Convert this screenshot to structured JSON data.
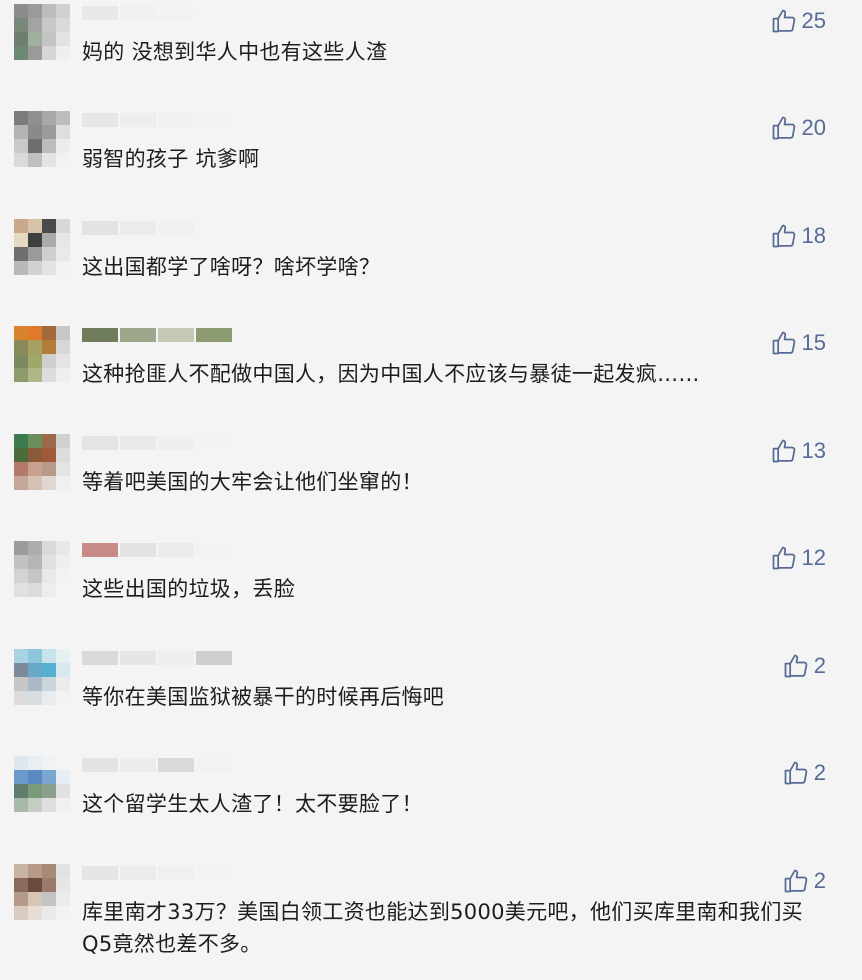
{
  "colors": {
    "like": "#576b95",
    "text": "#1d1d1d",
    "background": "#f4f4f4"
  },
  "comments": [
    {
      "text": "妈的  没想到华人中也有这些人渣",
      "likes": "25",
      "avatar": [
        "#8c8c8c",
        "#9a9a9a",
        "#bdbdbd",
        "#d0d0d0",
        "#7a8a7a",
        "#a3a3a3",
        "#c7c7c7",
        "#dadada",
        "#6f7f6f",
        "#9fb09f",
        "#c4c4c4",
        "#e2e2e2",
        "#6a8a74",
        "#9a9a9a",
        "#d6d6d6",
        "#efefef"
      ],
      "name": [
        "#e8e8e8",
        "#f0f0f0",
        "#f2f2f2",
        "#f4f4f4"
      ]
    },
    {
      "text": "弱智的孩子  坑爹啊",
      "likes": "20",
      "avatar": [
        "#7b7b7b",
        "#909090",
        "#a8a8a8",
        "#bdbdbd",
        "#b3b3b3",
        "#8a8a8a",
        "#9b9b9b",
        "#dedede",
        "#c9c9c9",
        "#6e6e6e",
        "#bcbcbc",
        "#ececec",
        "#dadada",
        "#bfbfbf",
        "#e4e4e4",
        "#f2f2f2"
      ],
      "name": [
        "#e6e6e6",
        "#eeeeee",
        "#f1f1f1",
        "#f3f3f3"
      ]
    },
    {
      "text": "这出国都学了啥呀？啥坏学啥？",
      "likes": "18",
      "avatar": [
        "#c9a98a",
        "#d8c3a8",
        "#4a4a4a",
        "#d7d7d7",
        "#e8d9c4",
        "#3f3f3f",
        "#aaaaaa",
        "#e6e6e6",
        "#6e6e6e",
        "#9a9a9a",
        "#cfcfcf",
        "#e9e9e9",
        "#b9b9b9",
        "#d1d1d1",
        "#e3e3e3",
        "#f2f2f2"
      ],
      "name": [
        "#e2e2e2",
        "#ebebeb",
        "#f0f0f0",
        "#f4f4f4"
      ]
    },
    {
      "text": "这种抢匪人不配做中国人，因为中国人不应该与暴徒一起发疯……",
      "likes": "15",
      "avatar": [
        "#d9832f",
        "#e07a2a",
        "#a06a3a",
        "#c7c7c7",
        "#8a8a5a",
        "#a8a060",
        "#b07d3a",
        "#d8d8d8",
        "#7c8a5e",
        "#9fa86a",
        "#cfcfcf",
        "#e4e4e4",
        "#8d9c6a",
        "#b0b58a",
        "#dcdcdc",
        "#efefef"
      ],
      "name": [
        "#6f7c5c",
        "#9ba68a",
        "#c3c9b5",
        "#8c9b70"
      ]
    },
    {
      "text": "等着吧美国的大牢会让他们坐窜的！",
      "likes": "13",
      "avatar": [
        "#3d7a4e",
        "#6a8f5a",
        "#9c6a4a",
        "#d0d0d0",
        "#4d6b3b",
        "#8a5a3a",
        "#a05a3a",
        "#dcdcdc",
        "#b37a6a",
        "#c9a090",
        "#b89a8a",
        "#e4e4e4",
        "#c6a89a",
        "#d6c0b5",
        "#e3d6d0",
        "#f0f0f0"
      ],
      "name": [
        "#e4e4e4",
        "#eaeaea",
        "#efefef",
        "#f3f3f3"
      ]
    },
    {
      "text": "这些出国的垃圾，丢脸",
      "likes": "12",
      "avatar": [
        "#9b9b9b",
        "#adadad",
        "#d9d9d9",
        "#e8e8e8",
        "#c2c2c2",
        "#b5b5b5",
        "#e0e0e0",
        "#efefef",
        "#d3d3d3",
        "#c6c6c6",
        "#e8e8e8",
        "#f2f2f2",
        "#e0e0e0",
        "#dbdbdb",
        "#ededed",
        "#f5f5f5"
      ],
      "name": [
        "#c98a8a",
        "#e2e2e2",
        "#ececec",
        "#f2f2f2"
      ]
    },
    {
      "text": "等你在美国监狱被暴干的时候再后悔吧",
      "likes": "2",
      "avatar": [
        "#a9d3e3",
        "#8ec7dc",
        "#c6e3ec",
        "#e6f0f3",
        "#7a8a9a",
        "#6aa8c8",
        "#55b0d0",
        "#d7e8ee",
        "#c6c6c6",
        "#aabac6",
        "#c9d7dd",
        "#ebebeb",
        "#dcdcdc",
        "#d6dde0",
        "#e8ecee",
        "#f3f3f3"
      ],
      "name": [
        "#dadada",
        "#e6e6e6",
        "#eeeeee",
        "#cfcfcf"
      ]
    },
    {
      "text": "这个留学生太人渣了！太不要脸了！",
      "likes": "2",
      "avatar": [
        "#dfe7ee",
        "#e9eef2",
        "#f0f3f5",
        "#f4f4f4",
        "#6a9ac8",
        "#5a8ac0",
        "#7aa6d0",
        "#e6eef4",
        "#5f7d6a",
        "#7a9a7a",
        "#8aa08a",
        "#e1e1e1",
        "#a9b9a9",
        "#c4ccc4",
        "#dedede",
        "#f0f0f0"
      ],
      "name": [
        "#e3e3e3",
        "#ececec",
        "#d9d9d9",
        "#f2f2f2"
      ]
    },
    {
      "text": "库里南才33万？美国白领工资也能达到5000美元吧，他们买库里南和我们买Q5竟然也差不多。",
      "likes": "2",
      "avatar": [
        "#c9b4a4",
        "#b69a86",
        "#a58a76",
        "#e2e2e2",
        "#8a6a5a",
        "#6a4a3a",
        "#9a7a6a",
        "#e6e6e6",
        "#b59a8a",
        "#d6c6b8",
        "#c3c3c3",
        "#ebebeb",
        "#dacbc0",
        "#e6ddd6",
        "#e9e9e9",
        "#f3f3f3"
      ],
      "name": [
        "#e5e5e5",
        "#ececec",
        "#f0f0f0",
        "#f3f3f3"
      ]
    }
  ]
}
